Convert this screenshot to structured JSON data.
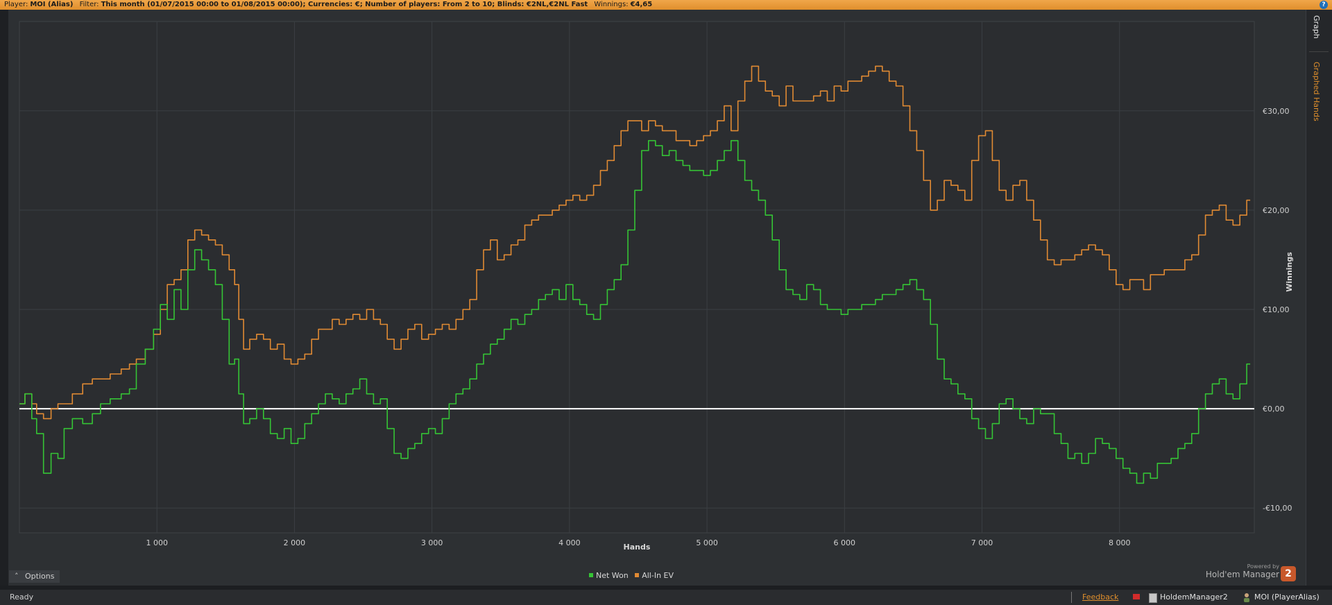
{
  "filter_bar": {
    "player_label": "Player:",
    "player_value": "MOI (Alias)",
    "filter_label": "Filter:",
    "filter_value": "This month (01/07/2015 00:00 to 01/08/2015 00:00); Currencies: €; Number of players: From 2 to 10; Blinds: €2NL,€2NL Fast",
    "winnings_label": "Winnings:",
    "winnings_value": "€4,65",
    "help_glyph": "?"
  },
  "side_tabs": {
    "graph": "Graph",
    "graphed_hands": "Graphed Hands"
  },
  "chart_data": {
    "type": "line",
    "xlabel": "Hands",
    "ylabel": "Winnings",
    "xlim": [
      0,
      8980
    ],
    "ylim": [
      -12.5,
      39
    ],
    "x_ticks": [
      1000,
      2000,
      3000,
      4000,
      5000,
      6000,
      7000,
      8000
    ],
    "x_tick_labels": [
      "1 000",
      "2 000",
      "3 000",
      "4 000",
      "5 000",
      "6 000",
      "7 000",
      "8 000"
    ],
    "y_ticks": [
      -10,
      0,
      10,
      20,
      30
    ],
    "y_tick_labels": [
      "-€10,00",
      "€0,00",
      "€10,00",
      "€20,00",
      "€30,00"
    ],
    "grid": true,
    "legend_position": "bottom-center",
    "zero_line": true,
    "series": [
      {
        "name": "Net Won",
        "color": "#35c435",
        "x": [
          0,
          80,
          100,
          150,
          200,
          260,
          300,
          350,
          420,
          500,
          560,
          620,
          700,
          780,
          820,
          880,
          950,
          1000,
          1050,
          1100,
          1150,
          1200,
          1250,
          1300,
          1350,
          1400,
          1450,
          1500,
          1550,
          1580,
          1610,
          1650,
          1700,
          1750,
          1800,
          1850,
          1900,
          1950,
          2000,
          2050,
          2100,
          2150,
          2200,
          2250,
          2300,
          2350,
          2400,
          2450,
          2500,
          2550,
          2600,
          2650,
          2700,
          2750,
          2800,
          2850,
          2900,
          2950,
          3000,
          3050,
          3100,
          3150,
          3200,
          3250,
          3300,
          3350,
          3400,
          3450,
          3500,
          3550,
          3600,
          3650,
          3700,
          3750,
          3800,
          3850,
          3900,
          3950,
          4000,
          4050,
          4100,
          4150,
          4200,
          4250,
          4300,
          4350,
          4400,
          4450,
          4500,
          4550,
          4600,
          4650,
          4700,
          4750,
          4800,
          4850,
          4900,
          4950,
          5000,
          5050,
          5100,
          5150,
          5200,
          5250,
          5300,
          5350,
          5400,
          5450,
          5500,
          5550,
          5600,
          5650,
          5700,
          5750,
          5800,
          5850,
          5900,
          5950,
          6000,
          6050,
          6100,
          6150,
          6200,
          6250,
          6300,
          6350,
          6400,
          6450,
          6500,
          6550,
          6600,
          6650,
          6700,
          6750,
          6800,
          6850,
          6900,
          6950,
          7000,
          7050,
          7100,
          7150,
          7200,
          7250,
          7300,
          7350,
          7400,
          7450,
          7500,
          7550,
          7600,
          7650,
          7700,
          7750,
          7800,
          7850,
          7900,
          7950,
          8000,
          8050,
          8100,
          8150,
          8200,
          8250,
          8300,
          8350,
          8400,
          8450,
          8500,
          8550,
          8600,
          8650,
          8700,
          8750,
          8800,
          8850,
          8900,
          8950
        ],
        "y": [
          0.5,
          1.5,
          -1.0,
          -2.5,
          -6.5,
          -4.5,
          -5.0,
          -2.0,
          -1.0,
          -1.5,
          -0.5,
          0.5,
          1.0,
          1.5,
          2.0,
          4.5,
          6.0,
          8.0,
          10.5,
          9.0,
          12.0,
          10.0,
          14.0,
          16.0,
          15.0,
          14.0,
          12.5,
          9.0,
          4.5,
          5.0,
          1.5,
          -1.5,
          -1.0,
          0.0,
          -1.0,
          -2.5,
          -3.0,
          -2.0,
          -3.5,
          -3.0,
          -1.5,
          -0.5,
          0.5,
          1.5,
          1.0,
          0.5,
          1.5,
          2.0,
          3.0,
          1.5,
          0.5,
          1.0,
          -2.0,
          -4.5,
          -5.0,
          -4.0,
          -3.5,
          -2.5,
          -2.0,
          -2.5,
          -1.0,
          0.5,
          1.5,
          2.0,
          3.0,
          4.5,
          5.5,
          6.5,
          7.0,
          8.0,
          9.0,
          8.5,
          9.5,
          10.0,
          11.0,
          11.5,
          12.0,
          11.0,
          12.5,
          11.0,
          10.5,
          9.5,
          9.0,
          10.5,
          12.0,
          13.0,
          14.5,
          18.0,
          22.0,
          26.0,
          27.0,
          26.5,
          25.5,
          26.0,
          25.0,
          24.5,
          24.0,
          24.0,
          23.5,
          24.0,
          25.0,
          26.0,
          27.0,
          25.0,
          23.0,
          22.0,
          21.0,
          19.5,
          17.0,
          14.0,
          12.0,
          11.5,
          11.0,
          12.5,
          12.0,
          10.5,
          10.0,
          10.0,
          9.5,
          10.0,
          10.0,
          10.5,
          10.5,
          11.0,
          11.5,
          11.5,
          12.0,
          12.5,
          13.0,
          12.0,
          11.0,
          8.5,
          5.0,
          3.0,
          2.5,
          1.5,
          1.0,
          -1.0,
          -2.0,
          -3.0,
          -1.5,
          0.5,
          1.0,
          0.0,
          -1.0,
          -1.5,
          0.0,
          -0.5,
          -0.5,
          -2.5,
          -3.5,
          -5.0,
          -4.5,
          -5.5,
          -4.5,
          -3.0,
          -3.5,
          -4.0,
          -5.0,
          -6.0,
          -6.5,
          -7.5,
          -6.5,
          -7.0,
          -5.5,
          -5.5,
          -5.0,
          -4.0,
          -3.5,
          -2.5,
          0.0,
          1.5,
          2.5,
          3.0,
          1.5,
          1.0,
          2.5,
          4.5
        ]
      },
      {
        "name": "All-In EV",
        "color": "#e08a33",
        "x": [
          0,
          80,
          100,
          150,
          200,
          260,
          300,
          350,
          420,
          500,
          560,
          620,
          700,
          780,
          820,
          880,
          950,
          1000,
          1050,
          1100,
          1150,
          1200,
          1250,
          1300,
          1350,
          1400,
          1450,
          1500,
          1550,
          1580,
          1610,
          1650,
          1700,
          1750,
          1800,
          1850,
          1900,
          1950,
          2000,
          2050,
          2100,
          2150,
          2200,
          2250,
          2300,
          2350,
          2400,
          2450,
          2500,
          2550,
          2600,
          2650,
          2700,
          2750,
          2800,
          2850,
          2900,
          2950,
          3000,
          3050,
          3100,
          3150,
          3200,
          3250,
          3300,
          3350,
          3400,
          3450,
          3500,
          3550,
          3600,
          3650,
          3700,
          3750,
          3800,
          3850,
          3900,
          3950,
          4000,
          4050,
          4100,
          4150,
          4200,
          4250,
          4300,
          4350,
          4400,
          4450,
          4500,
          4550,
          4600,
          4650,
          4700,
          4750,
          4800,
          4850,
          4900,
          4950,
          5000,
          5050,
          5100,
          5150,
          5200,
          5250,
          5300,
          5350,
          5400,
          5450,
          5500,
          5550,
          5600,
          5650,
          5700,
          5750,
          5800,
          5850,
          5900,
          5950,
          6000,
          6050,
          6100,
          6150,
          6200,
          6250,
          6300,
          6350,
          6400,
          6450,
          6500,
          6550,
          6600,
          6650,
          6700,
          6750,
          6800,
          6850,
          6900,
          6950,
          7000,
          7050,
          7100,
          7150,
          7200,
          7250,
          7300,
          7350,
          7400,
          7450,
          7500,
          7550,
          7600,
          7650,
          7700,
          7750,
          7800,
          7850,
          7900,
          7950,
          8000,
          8050,
          8100,
          8150,
          8200,
          8250,
          8300,
          8350,
          8400,
          8450,
          8500,
          8550,
          8600,
          8650,
          8700,
          8750,
          8800,
          8850,
          8900,
          8950
        ],
        "y": [
          0.5,
          1.5,
          0.5,
          -0.5,
          -1.0,
          0.0,
          0.5,
          0.5,
          1.5,
          2.5,
          3.0,
          3.0,
          3.5,
          4.0,
          4.5,
          5.0,
          6.0,
          7.5,
          10.0,
          12.5,
          13.0,
          14.0,
          17.0,
          18.0,
          17.5,
          17.0,
          16.5,
          15.5,
          14.0,
          12.5,
          9.0,
          6.0,
          7.0,
          7.5,
          7.0,
          6.0,
          6.5,
          5.0,
          4.5,
          5.0,
          5.5,
          7.0,
          8.0,
          8.0,
          9.0,
          8.5,
          9.0,
          9.5,
          9.0,
          10.0,
          9.0,
          8.5,
          7.0,
          6.0,
          7.0,
          8.0,
          8.5,
          7.0,
          7.5,
          8.0,
          8.5,
          8.0,
          9.0,
          10.0,
          11.0,
          14.0,
          16.0,
          17.0,
          15.0,
          15.5,
          16.5,
          17.0,
          18.5,
          19.0,
          19.5,
          19.5,
          20.0,
          20.5,
          21.0,
          21.5,
          21.0,
          21.5,
          22.5,
          24.0,
          25.0,
          26.5,
          28.0,
          29.0,
          29.0,
          28.0,
          29.0,
          28.5,
          28.0,
          28.0,
          27.0,
          27.0,
          26.5,
          27.0,
          27.5,
          28.0,
          29.0,
          30.5,
          28.0,
          31.0,
          33.0,
          34.5,
          33.0,
          32.0,
          31.5,
          30.5,
          32.5,
          31.0,
          31.0,
          31.0,
          31.5,
          32.0,
          31.0,
          32.5,
          32.0,
          33.0,
          33.0,
          33.5,
          34.0,
          34.5,
          34.0,
          33.0,
          32.5,
          30.5,
          28.0,
          26.0,
          23.0,
          20.0,
          21.0,
          23.0,
          22.5,
          22.0,
          21.0,
          25.0,
          27.5,
          28.0,
          25.0,
          22.0,
          21.0,
          22.5,
          23.0,
          21.0,
          19.0,
          17.0,
          15.0,
          14.5,
          15.0,
          15.0,
          15.5,
          16.0,
          16.5,
          16.0,
          15.5,
          14.0,
          12.5,
          12.0,
          13.0,
          13.0,
          12.0,
          13.5,
          13.5,
          14.0,
          14.0,
          14.0,
          15.0,
          15.5,
          17.5,
          19.5,
          20.0,
          20.5,
          19.0,
          18.5,
          19.5,
          21.0
        ]
      }
    ]
  },
  "legend": {
    "items": [
      {
        "label": "Net Won",
        "color": "#35c435"
      },
      {
        "label": "All-In EV",
        "color": "#e08a33"
      }
    ]
  },
  "options_button": {
    "label": "Options",
    "icon": "chevron-up-icon",
    "glyph": "˄"
  },
  "branding": {
    "powered_by": "Powered by",
    "product": "Hold'em Manager",
    "badge": "2"
  },
  "status_bar": {
    "ready": "Ready",
    "feedback": "Feedback",
    "app_name": "HoldemManager2",
    "player": "MOI (PlayerAlias)"
  }
}
